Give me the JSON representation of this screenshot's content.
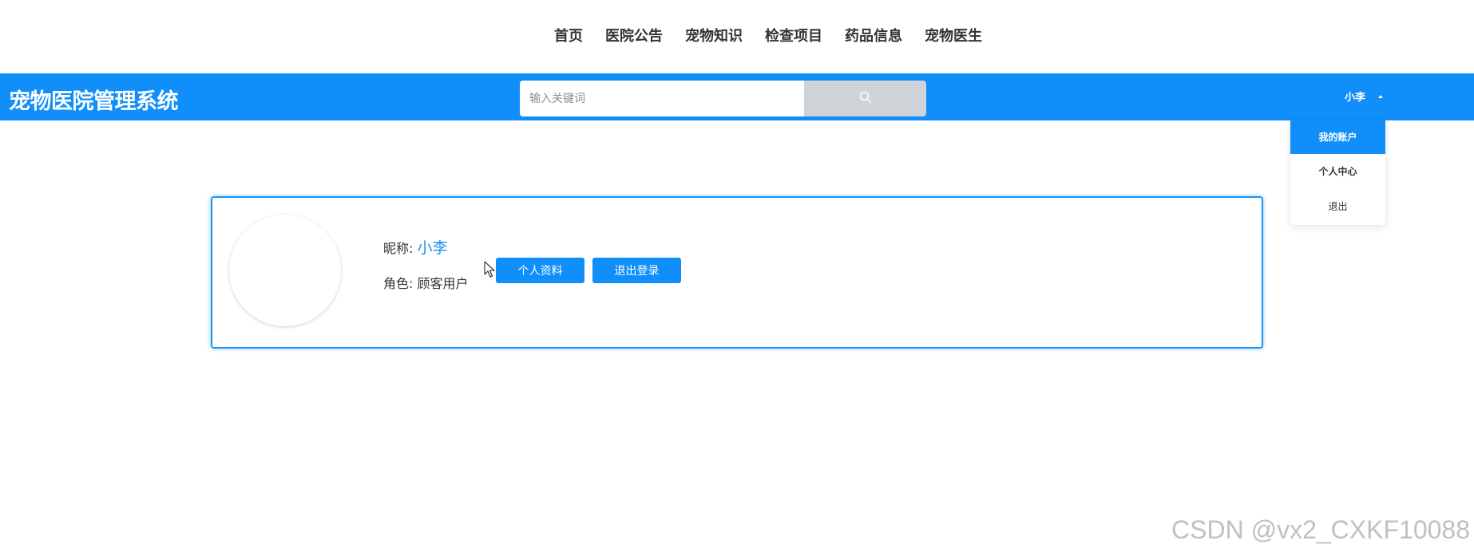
{
  "nav": {
    "items": [
      {
        "label": "首页"
      },
      {
        "label": "医院公告"
      },
      {
        "label": "宠物知识"
      },
      {
        "label": "检查项目"
      },
      {
        "label": "药品信息"
      },
      {
        "label": "宠物医生"
      }
    ]
  },
  "header": {
    "brand": "宠物医院管理系统",
    "search": {
      "placeholder": "输入关键词",
      "value": "",
      "icon": "search-icon"
    },
    "user": {
      "name": "小李",
      "caret_icon": "caret-up-icon"
    }
  },
  "dropdown": {
    "items": [
      {
        "label": "我的账户",
        "active": true
      },
      {
        "label": "个人中心"
      },
      {
        "label": "退出"
      }
    ]
  },
  "profile": {
    "nick_label": "昵称: ",
    "nick_value": "小李",
    "role_label": "角色: ",
    "role_value": "顾客用户",
    "profile_button": "个人资料",
    "logout_button": "退出登录"
  },
  "watermark": "CSDN @vx2_CXKF10088",
  "colors": {
    "primary": "#108ef9",
    "search_button": "#cfd2d7",
    "nick_value": "#1a8cf0"
  }
}
